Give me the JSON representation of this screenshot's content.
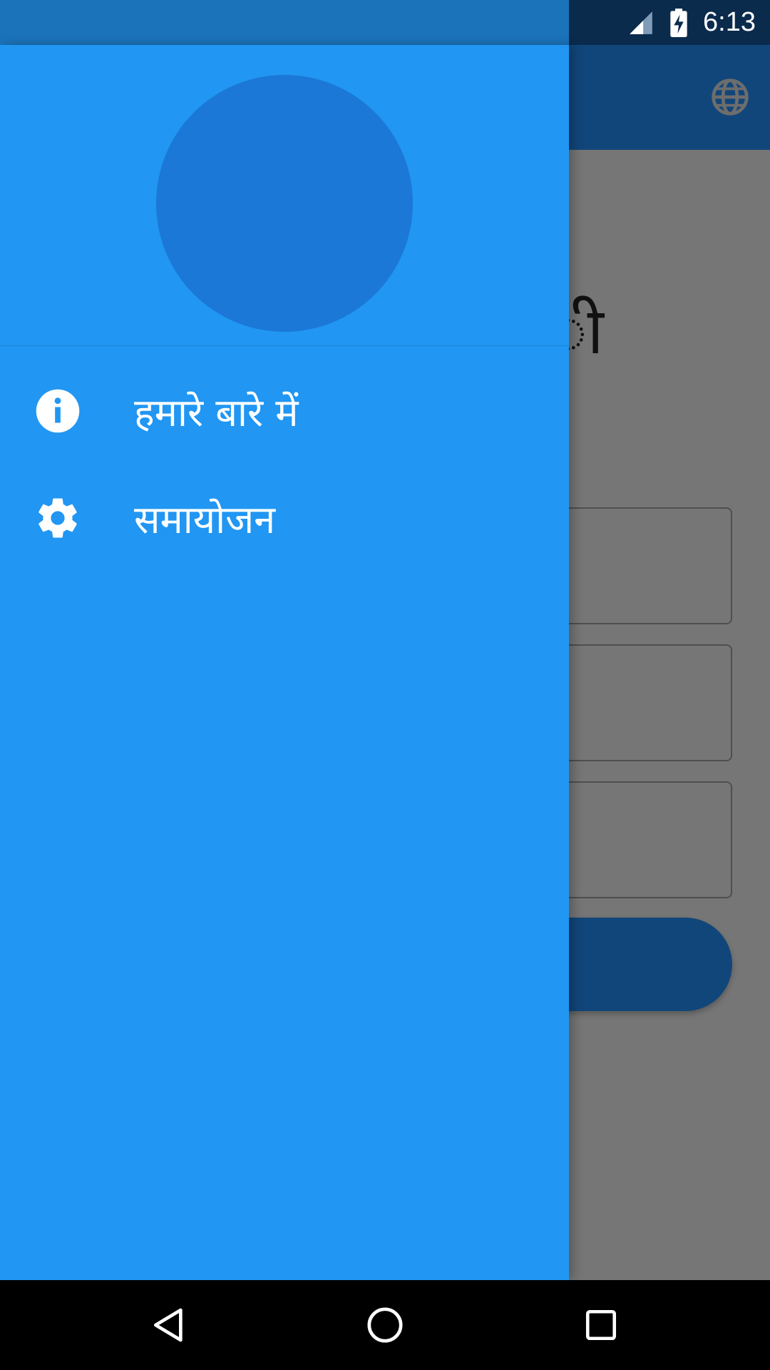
{
  "status_bar": {
    "time": "6:13",
    "icons": [
      "signal-icon",
      "battery-charging-icon"
    ]
  },
  "app_bar": {
    "action_icon": "globe-icon"
  },
  "background": {
    "title_fragment": "ी"
  },
  "drawer": {
    "menu": [
      {
        "icon": "info-icon",
        "label": "हमारे बारे में"
      },
      {
        "icon": "gear-icon",
        "label": "समायोजन"
      }
    ]
  },
  "nav_bar": {
    "buttons": [
      "back-icon",
      "home-icon",
      "recents-icon"
    ]
  },
  "colors": {
    "drawer": "#2196f3",
    "avatar": "#1b78d6",
    "app_bar_dimmed": "#11467a",
    "scrim_content": "#767676"
  }
}
